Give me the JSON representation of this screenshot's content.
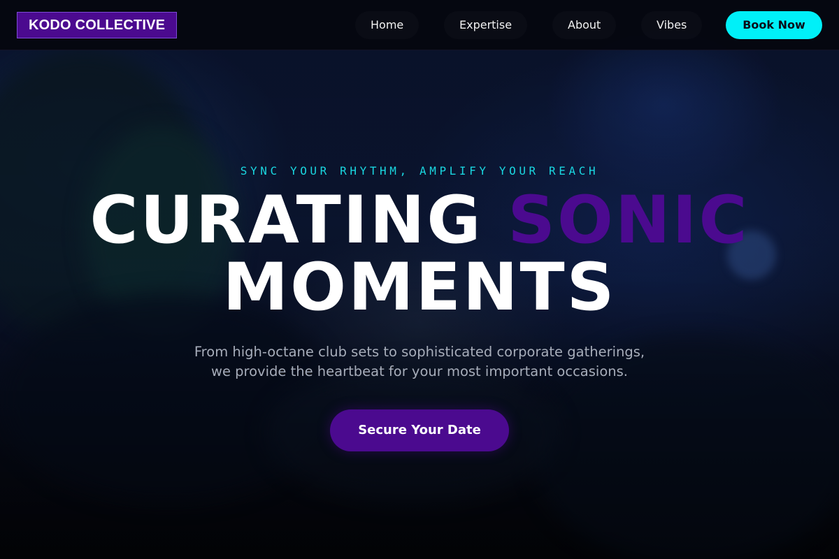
{
  "nav": {
    "logo": "KODO COLLECTIVE",
    "links": [
      "Home",
      "Expertise",
      "About",
      "Vibes"
    ],
    "cta_label": "Book Now"
  },
  "hero": {
    "tagline": "SYNC YOUR RHYTHM, AMPLIFY YOUR REACH",
    "headline_part1": "CURATING",
    "headline_accent": "SONIC",
    "headline_part2": "MOMENTS",
    "subtext_line1": "From high-octane club sets to sophisticated corporate gatherings,",
    "subtext_line2": "we provide the heartbeat for your most important occasions.",
    "cta_label": "Secure Your Date"
  },
  "colors": {
    "brand_purple": "#4b0a8f",
    "accent_cyan": "#00f0f8",
    "tagline_cyan": "#1ad6e0",
    "background": "#0a1430"
  }
}
